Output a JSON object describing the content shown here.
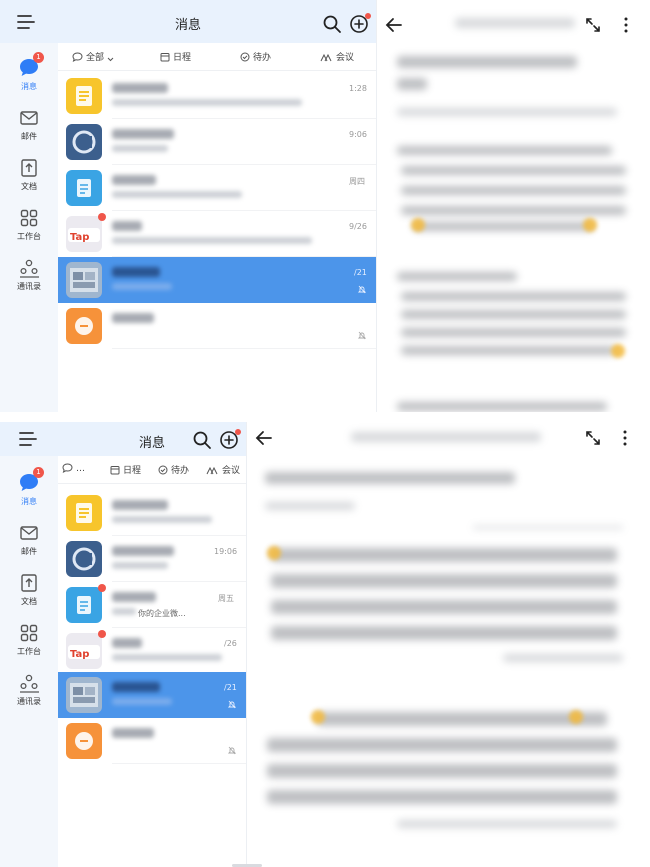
{
  "colors": {
    "accent": "#2f7df6",
    "selected_row": "#4c95ea",
    "badge": "#f0564a",
    "appbar": "#e9f2fd",
    "rail": "#f3f7fc"
  },
  "top": {
    "appbar": {
      "title": "消息"
    },
    "rail": [
      {
        "label": "消息",
        "icon": "chat-bubble-icon",
        "badge": "1",
        "active": true
      },
      {
        "label": "邮件",
        "icon": "mail-icon"
      },
      {
        "label": "文档",
        "icon": "doc-icon"
      },
      {
        "label": "工作台",
        "icon": "grid-icon"
      },
      {
        "label": "通讯录",
        "icon": "contacts-icon"
      }
    ],
    "filters": {
      "all": "全部",
      "schedule": "日程",
      "todo": "待办",
      "meeting": "会议"
    },
    "rows": [
      {
        "time": "1:28",
        "sub": ""
      },
      {
        "time": "9:06",
        "sub": ""
      },
      {
        "time": "周四",
        "sub": ""
      },
      {
        "time": "9/26",
        "sub": ""
      },
      {
        "time": "/21",
        "sub": ""
      },
      {
        "time": "",
        "sub": ""
      }
    ]
  },
  "bottom": {
    "appbar": {
      "title": "消息"
    },
    "rail": [
      {
        "label": "消息",
        "badge": "1"
      },
      {
        "label": "邮件"
      },
      {
        "label": "文档"
      },
      {
        "label": "工作台"
      },
      {
        "label": "通讯录"
      }
    ],
    "filters": {
      "all": "…",
      "schedule": "日程",
      "todo": "待办",
      "meeting": "会议"
    },
    "rows": [
      {
        "time": "",
        "sub": ""
      },
      {
        "time": "19:06",
        "sub": ""
      },
      {
        "time": "周五",
        "sub": "你的企业微..."
      },
      {
        "time": "/26",
        "sub": ""
      },
      {
        "time": "/21",
        "sub": ""
      },
      {
        "time": "",
        "sub": ""
      }
    ]
  }
}
